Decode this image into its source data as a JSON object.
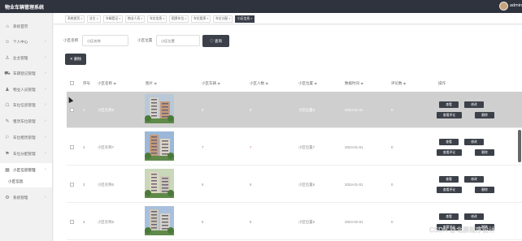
{
  "app": {
    "title": "物业车辆管理系统",
    "user": "admin"
  },
  "sidebar": {
    "items": [
      {
        "label": "系统首页",
        "icon": "home-icon",
        "glyph": "⌂"
      },
      {
        "label": "个人中心",
        "icon": "user-icon",
        "glyph": "☺"
      },
      {
        "label": "业主管理",
        "icon": "owner-icon",
        "glyph": "♙"
      },
      {
        "label": "车辆登记管理",
        "icon": "car-icon",
        "glyph": "⛟"
      },
      {
        "label": "物业人员管理",
        "icon": "staff-icon",
        "glyph": "♟"
      },
      {
        "label": "车位信息管理",
        "icon": "parking-icon",
        "glyph": "☖"
      },
      {
        "label": "租赁车位管理",
        "icon": "lease-icon",
        "glyph": "✎"
      },
      {
        "label": "车位租赁管理",
        "icon": "rent-icon",
        "glyph": "⚐"
      },
      {
        "label": "车位分配管理",
        "icon": "assign-icon",
        "glyph": "⚑"
      },
      {
        "label": "小区信息管理",
        "icon": "community-icon",
        "glyph": "▦"
      },
      {
        "label": "小区信息",
        "icon": "",
        "glyph": ""
      },
      {
        "label": "系统管理",
        "icon": "settings-icon",
        "glyph": "⚙"
      }
    ]
  },
  "tabs": [
    "系统首页 ×",
    "业主 ×",
    "车辆登记 ×",
    "物业人员 ×",
    "车位信息 ×",
    "租赁车位 ×",
    "车位租赁 ×",
    "车位分配 ×",
    "小区信息 ×"
  ],
  "filters": {
    "name_label": "小区名称",
    "name_placeholder": "小区名称",
    "loc_label": "小区位置",
    "loc_placeholder": "小区位置",
    "search_label": "♡ 查询",
    "delete_label": "✕ 删除"
  },
  "table": {
    "headers": [
      "序号",
      "小区名称 ≑",
      "图片 ≑",
      "小区车辆 ≑",
      "小区人数 ≑",
      "小区位置 ≑",
      "数据时间 ≑",
      "评论数 ≑",
      "操作"
    ],
    "rows": [
      {
        "idx": "1",
        "name": "小区名称8",
        "vehicles": "8",
        "people": "8",
        "loc": "小区位置8",
        "time": "2024-01-31",
        "comments": "0"
      },
      {
        "idx": "2",
        "name": "小区名称7",
        "vehicles": "7",
        "people": "7",
        "loc": "小区位置7",
        "time": "2024-01-01",
        "comments": "0"
      },
      {
        "idx": "3",
        "name": "小区名称6",
        "vehicles": "6",
        "people": "6",
        "loc": "小区位置6",
        "time": "2024-01-01",
        "comments": "0"
      },
      {
        "idx": "4",
        "name": "小区名称5",
        "vehicles": "5",
        "people": "5",
        "loc": "小区位置5",
        "time": "2024-02-01",
        "comments": "0"
      }
    ],
    "actions": {
      "view": "查看",
      "edit": "修改",
      "comments": "查看评论",
      "delete": "删除"
    }
  },
  "watermark": "CSDN @北辰程序设计",
  "colors": {
    "topbar": "#2f333d",
    "button": "#3b4049",
    "highlight_row": "#cfcfcf",
    "people_accent": "#e06c6c"
  }
}
